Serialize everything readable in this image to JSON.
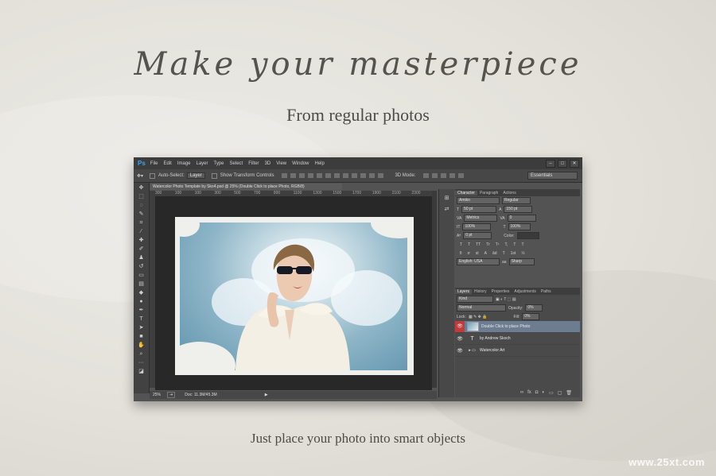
{
  "headline": "Make your masterpiece",
  "subhead": "From regular photos",
  "caption": "Just place your photo into smart objects",
  "watermark": "www.25xt.com",
  "ps": {
    "logo": "Ps",
    "menu": [
      "File",
      "Edit",
      "Image",
      "Layer",
      "Type",
      "Select",
      "Filter",
      "3D",
      "View",
      "Window",
      "Help"
    ],
    "window_buttons": [
      "–",
      "□",
      "✕"
    ],
    "options": {
      "auto_select": "Auto-Select:",
      "auto_select_value": "Layer",
      "show_transform": "Show Transform Controls",
      "mode_3d": "3D Mode:",
      "workspace": "Essentials"
    },
    "doc_tab": "Watercolor Photo Template by Sko4.psd @ 25% (Double Click to place Photo, RGB/8)",
    "ruler_ticks": [
      "300",
      "200",
      "100",
      "0",
      "100",
      "200",
      "300",
      "400",
      "500",
      "600",
      "700",
      "800",
      "900",
      "1000",
      "1100",
      "1200",
      "1300",
      "1400",
      "1500",
      "1600",
      "1700",
      "1800",
      "1900",
      "2000",
      "2100",
      "2200",
      "2300",
      "2400"
    ],
    "status": {
      "zoom": "25%",
      "doc": "Doc: 11.3M/45.3M"
    },
    "character": {
      "tabs": [
        "Character",
        "Paragraph",
        "Actions"
      ],
      "font": "Amiko",
      "style": "Regular",
      "size": "50 pt",
      "leading": "150 pt",
      "kerning": "Metrics",
      "tracking": "0",
      "vscale": "100%",
      "hscale": "100%",
      "baseline": "0 pt",
      "color_label": "Color:",
      "type_styles": [
        "T",
        "T",
        "TT",
        "Tr",
        "T¹",
        "T,",
        "T",
        "T"
      ],
      "glyphs": [
        "fi",
        "ơ",
        "st",
        "A",
        "ād",
        "T",
        "1st",
        "½"
      ],
      "language": "English: USA",
      "aa_icon": "aa",
      "antialias": "Sharp"
    },
    "layers": {
      "tabs": [
        "Layers",
        "History",
        "Properties",
        "Adjustments",
        "Paths"
      ],
      "kind": "Kind",
      "blend": "Normal",
      "opacity_label": "Opacity:",
      "opacity": "0%",
      "lock_label": "Lock:",
      "fill_label": "Fill:",
      "fill": "0%",
      "items": [
        {
          "name": "Double Click to place Photo",
          "type": "smart"
        },
        {
          "name": "by Andrew   Skoch",
          "type": "text"
        },
        {
          "name": "Watercolor Art",
          "type": "group"
        }
      ],
      "footer_icons": [
        "link",
        "fx",
        "mask",
        "adjust",
        "folder",
        "new",
        "trash"
      ]
    }
  }
}
